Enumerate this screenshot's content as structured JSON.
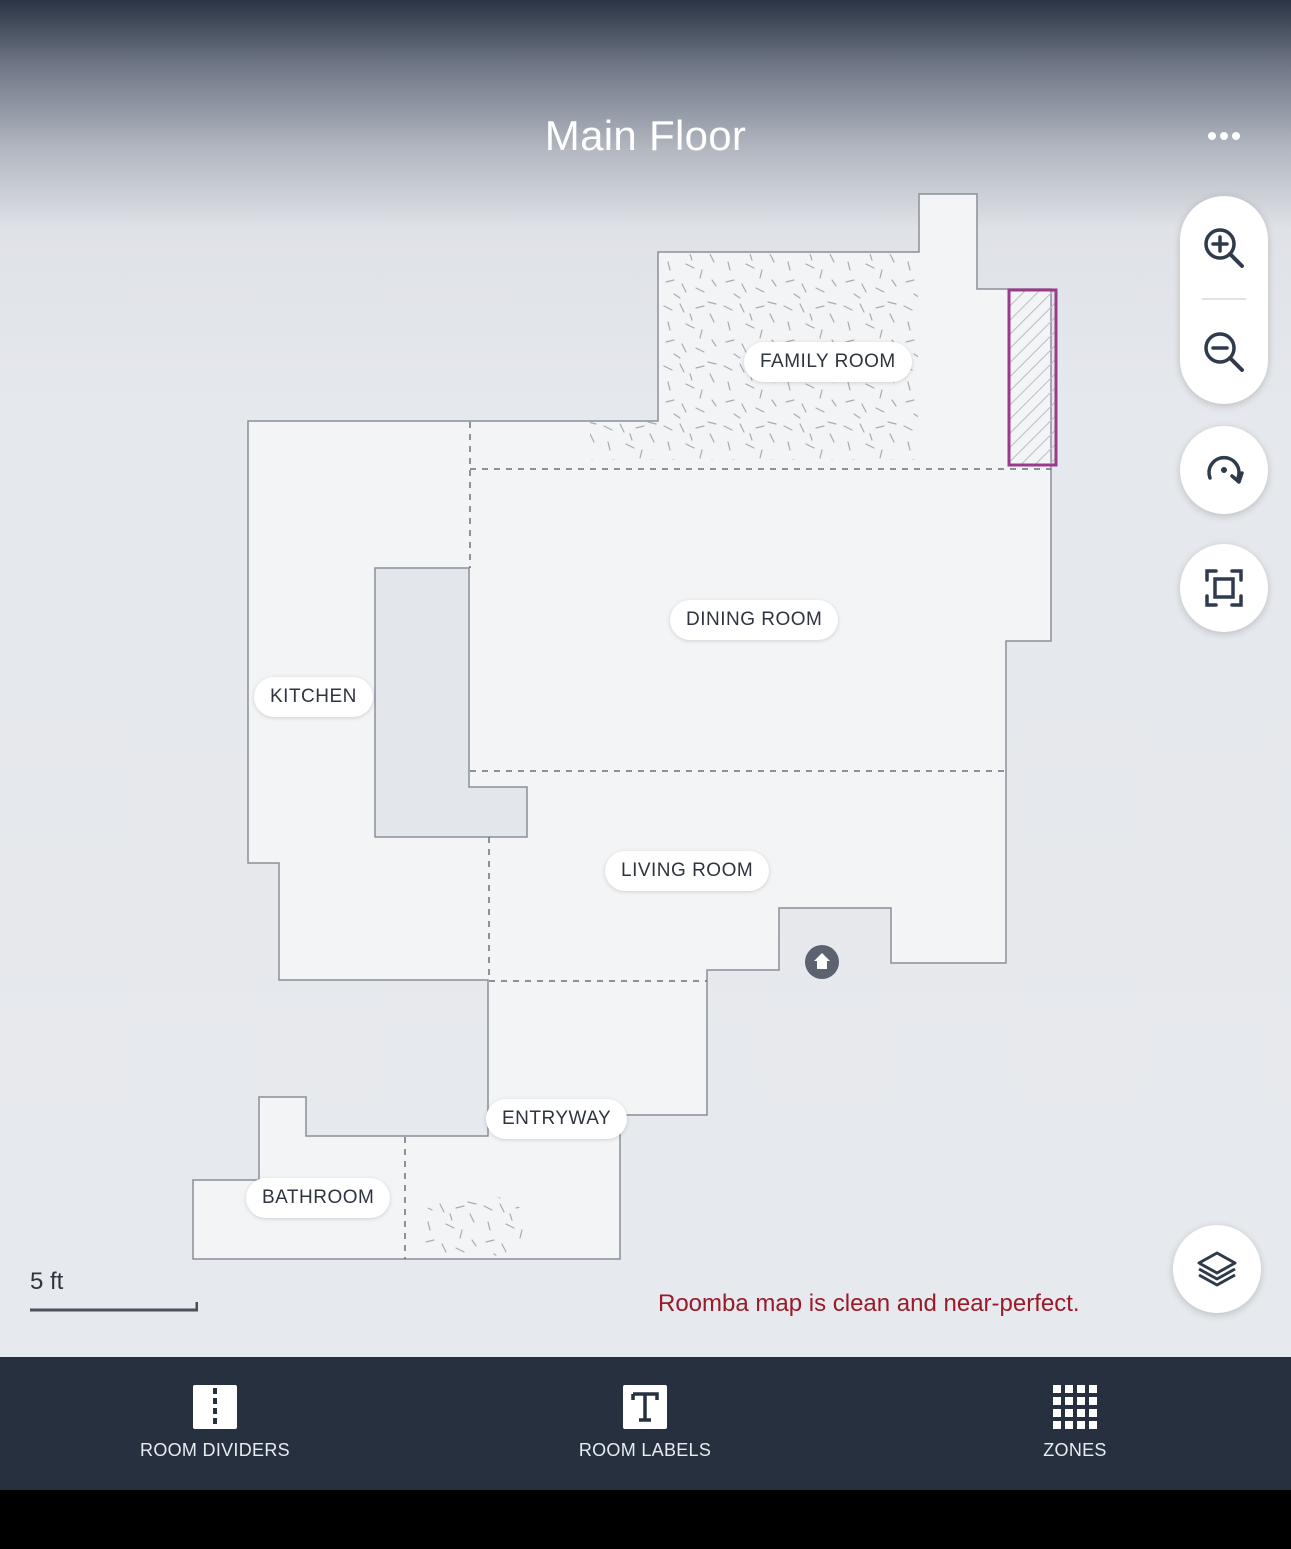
{
  "header": {
    "title": "Main Floor"
  },
  "map": {
    "rooms": [
      {
        "id": "family",
        "label": "FAMILY ROOM"
      },
      {
        "id": "dining",
        "label": "DINING ROOM"
      },
      {
        "id": "kitchen",
        "label": "KITCHEN"
      },
      {
        "id": "living",
        "label": "LIVING ROOM"
      },
      {
        "id": "entryway",
        "label": "ENTRYWAY"
      },
      {
        "id": "bathroom",
        "label": "BATHROOM"
      }
    ],
    "scale_label": "5 ft",
    "caption": "Roomba map is clean and near-perfect.",
    "colors": {
      "floor": "#f3f4f6",
      "wall": "#8a9099",
      "obstacle": "#e3e6eb",
      "keep_out_zone": "#9b3a8c",
      "dock": "#5b6270"
    }
  },
  "controls": {
    "icons": [
      "zoom-in-icon",
      "zoom-out-icon",
      "rotate-icon",
      "fit-to-screen-icon",
      "layers-icon",
      "more-icon"
    ]
  },
  "bottom_nav": {
    "tabs": [
      {
        "label": "ROOM DIVIDERS",
        "icon": "room-dividers-icon"
      },
      {
        "label": "ROOM LABELS",
        "icon": "room-labels-icon"
      },
      {
        "label": "ZONES",
        "icon": "zones-icon"
      }
    ]
  }
}
